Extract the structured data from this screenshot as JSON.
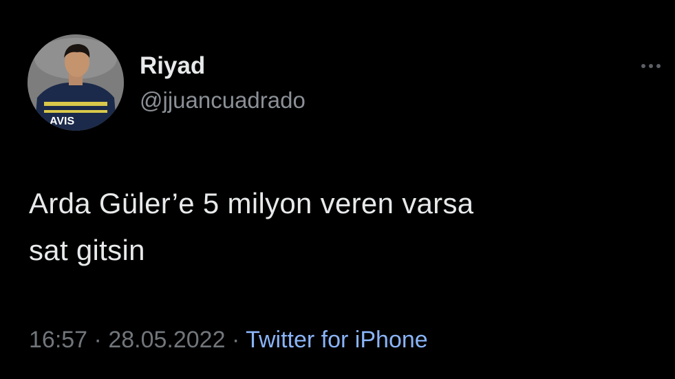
{
  "tweet": {
    "author": {
      "display_name": "Riyad",
      "handle": "@jjuancuadrado",
      "avatar_jersey_text": "AVIS"
    },
    "text_lines": [
      "Arda Güler’e 5 milyon veren varsa",
      "sat gitsin"
    ],
    "meta": {
      "time": "16:57",
      "separator": "·",
      "date": "28.05.2022",
      "source": "Twitter for iPhone"
    },
    "more_icon": "more-horizontal-icon"
  },
  "colors": {
    "background": "#000000",
    "primary_text": "#e7e9ea",
    "secondary_text": "#71767b",
    "link": "#8ab4f8"
  }
}
